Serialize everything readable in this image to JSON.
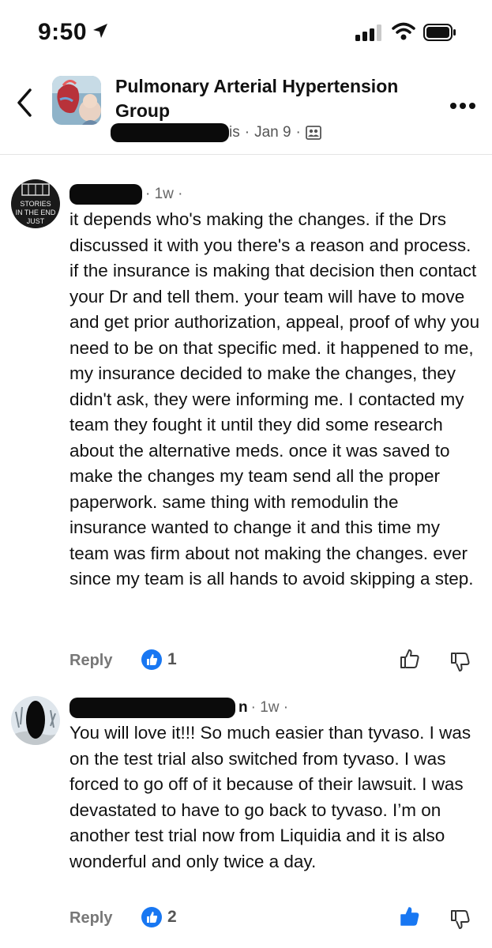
{
  "status_bar": {
    "time": "9:50"
  },
  "header": {
    "group_name": "Pulmonary Arterial Hypertension Group",
    "post_meta": {
      "author_visible": "is",
      "sep1": "·",
      "date": "Jan 9",
      "sep2": "·"
    }
  },
  "comments": [
    {
      "name_visible": "",
      "time": "· 1w ·",
      "avatar_text": "STORIES IN THE END JUST",
      "text": "it depends who's making the changes. if the Drs discussed it with you there's a reason and process. if the insurance is making that decision then contact your Dr and tell them. your team will have to move and get prior authorization, appeal, proof of why you need to be on that specific med. it happened to me, my insurance decided to make the changes, they didn't ask, they were informing me. I contacted my team they fought it until they did some research about the alternative meds. once it was saved to make the changes my team send all the proper paperwork. same thing with remodulin the insurance wanted to change it and this time my team was firm about not making the changes. ever since my team is all hands to avoid skipping a step.",
      "reply_label": "Reply",
      "like_count": "1",
      "liked": false
    },
    {
      "name_visible": "n",
      "time": "· 1w ·",
      "text": "You will love it!!! So much easier than tyvaso. I was on the test trial also switched from tyvaso. I was forced to go off of it because of their lawsuit.  I was devastated to have to go back to tyvaso. I’m on another test trial now from Liquidia and it is also wonderful and only twice a day.",
      "reply_label": "Reply",
      "like_count": "2",
      "liked": true
    }
  ],
  "colors": {
    "brand_blue": "#1877f2",
    "text": "#111111",
    "meta": "#666666"
  }
}
